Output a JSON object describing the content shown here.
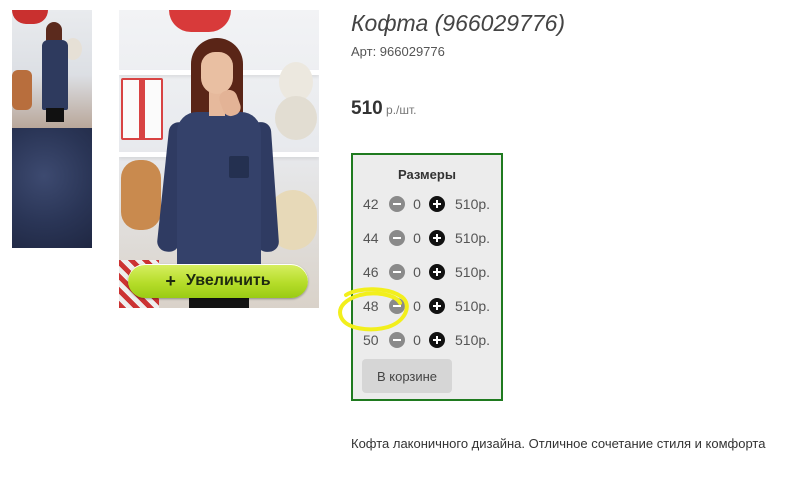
{
  "product": {
    "title": "Кофта (966029776)",
    "sku": "Арт: 966029776",
    "price": "510",
    "price_unit": " р./шт.",
    "description": "Кофта лаконичного дизайна. Отличное сочетание стиля и комфорта"
  },
  "gallery": {
    "zoom_plus": "+",
    "zoom_label": "Увеличить"
  },
  "sizes": {
    "title": "Размеры",
    "rows": [
      {
        "size": "42",
        "qty": "0",
        "price": "510р."
      },
      {
        "size": "44",
        "qty": "0",
        "price": "510р."
      },
      {
        "size": "46",
        "qty": "0",
        "price": "510р."
      },
      {
        "size": "48",
        "qty": "0",
        "price": "510р."
      },
      {
        "size": "50",
        "qty": "0",
        "price": "510р."
      }
    ],
    "cart_label": "В корзине"
  },
  "colors": {
    "size_box_border": "#1f7a1f",
    "zoom_button": "#b6dd2a",
    "highlight_annotation": "#f2ef1c"
  }
}
